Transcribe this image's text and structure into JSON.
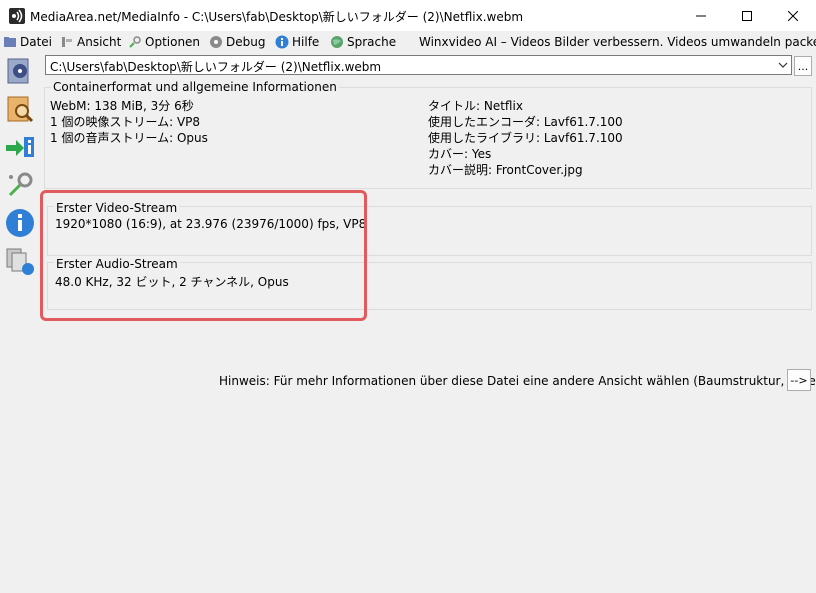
{
  "window": {
    "title": "MediaArea.net/MediaInfo - C:\\Users\\fab\\Desktop\\新しいフォルダー (2)\\Netflix.webm"
  },
  "menu": {
    "datei": "Datei",
    "ansicht": "Ansicht",
    "optionen": "Optionen",
    "debug": "Debug",
    "hilfe": "Hilfe",
    "sprache": "Sprache",
    "promo": "Winxvideo AI – Videos  Bilder verbessern. Videos umwandeln  packen"
  },
  "file": {
    "path": "C:\\Users\\fab\\Desktop\\新しいフォルダー (2)\\Netflix.webm",
    "browse_label": "..."
  },
  "container": {
    "title": "Containerformat und allgemeine Informationen",
    "left": [
      "WebM: 138 MiB, 3分 6秒",
      "1 個の映像ストリーム: VP8",
      "1 個の音声ストリーム: Opus"
    ],
    "right": [
      "タイトル: Netflix",
      "使用したエンコーダ: Lavf61.7.100",
      "使用したライブラリ: Lavf61.7.100",
      "カバー: Yes",
      "カバー説明: FrontCover.jpg"
    ]
  },
  "video": {
    "title": "Erster Video-Stream",
    "info": "1920*1080 (16:9), at 23.976 (23976/1000) fps, VP8"
  },
  "audio": {
    "title": "Erster Audio-Stream",
    "info": "48.0 KHz, 32 ビット, 2 チャンネル, Opus"
  },
  "hint": {
    "text": "Hinweis: Für mehr Informationen über diese Datei eine andere Ansicht wählen (Baumstruktur, Tabelle...)",
    "button": "-->"
  },
  "colors": {
    "highlight": "#e25a5e"
  }
}
